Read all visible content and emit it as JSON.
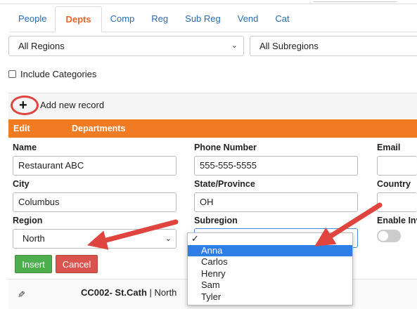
{
  "tabs": [
    "People",
    "Depts",
    "Comp",
    "Reg",
    "Sub Reg",
    "Vend",
    "Cat"
  ],
  "active_tab": "Depts",
  "filters": {
    "region_select": "All Regions",
    "subregion_select": "All Subregions"
  },
  "include_categories_label": "Include Categories",
  "add_record_label": "Add new record",
  "header": {
    "edit": "Edit",
    "departments": "Departments"
  },
  "form": {
    "name_label": "Name",
    "name_value": "Restaurant ABC",
    "phone_label": "Phone Number",
    "phone_value": "555-555-5555",
    "email_label": "Email",
    "city_label": "City",
    "city_value": "Columbus",
    "state_label": "State/Province",
    "state_value": "OH",
    "country_label": "Country",
    "region_label": "Region",
    "region_value": "North",
    "subregion_label": "Subregion",
    "enable_label": "Enable Inv"
  },
  "buttons": {
    "insert": "Insert",
    "cancel": "Cancel"
  },
  "dropdown": {
    "check": "✓",
    "items": [
      "Anna",
      "Carlos",
      "Henry",
      "Sam",
      "Tyler"
    ],
    "highlighted": "Anna"
  },
  "record": {
    "code": "CC002- St.Cath",
    "sep": " | ",
    "region": "North"
  },
  "colors": {
    "accent": "#f07b22",
    "link": "#2a6db3",
    "annotation": "#e0443f",
    "insert": "#4cae4c",
    "cancel": "#d9534f",
    "highlight": "#2f7ee6"
  }
}
